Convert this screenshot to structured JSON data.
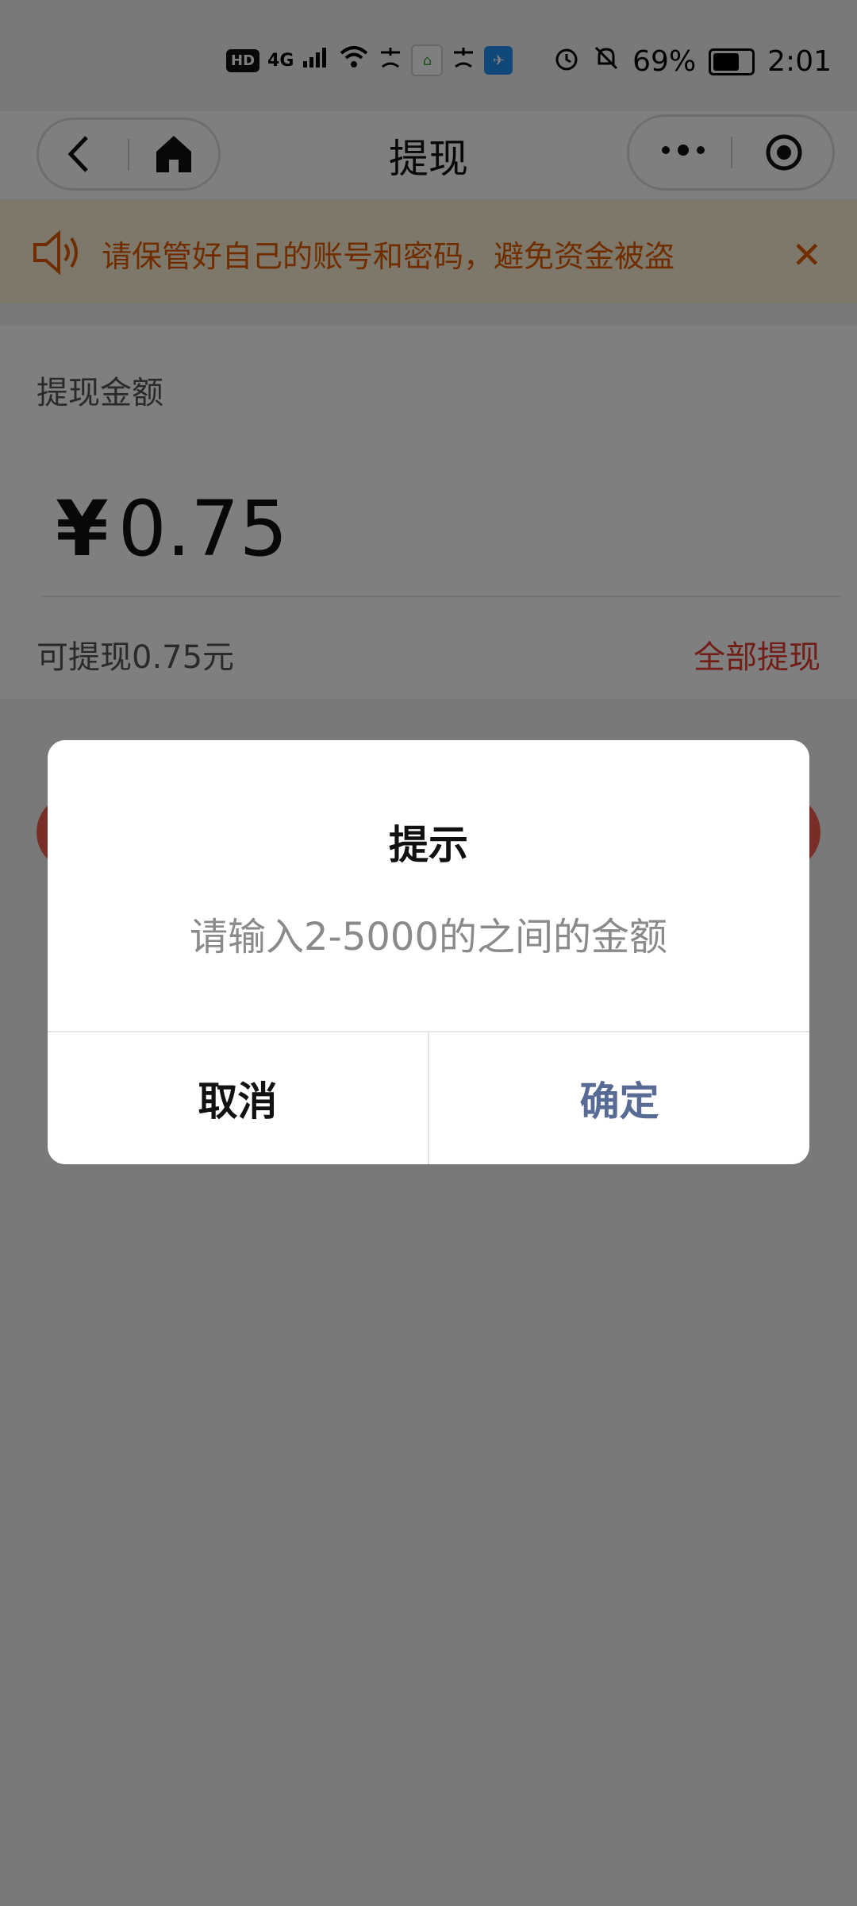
{
  "status_bar": {
    "network": "4G",
    "battery": "69%",
    "time": "2:01",
    "badges": [
      "HD"
    ],
    "icons": [
      "signal-icon",
      "wifi-icon",
      "alipay-icon",
      "app-icon",
      "alipay-icon",
      "app-icon",
      "alarm-icon",
      "mute-icon",
      "battery-icon"
    ]
  },
  "nav": {
    "title": "提现"
  },
  "notice": {
    "text": "请保管好自己的账号和密码，避免资金被盗"
  },
  "withdraw": {
    "label": "提现金额",
    "currency": "¥",
    "amount": "0.75",
    "available": "可提现0.75元",
    "all_label": "全部提现"
  },
  "dialog": {
    "title": "提示",
    "message": "请输入2-5000的之间的金额",
    "cancel": "取消",
    "ok": "确定"
  },
  "colors": {
    "notice": "#e05b00",
    "accent": "#e23c2d",
    "ok": "#576b95"
  }
}
